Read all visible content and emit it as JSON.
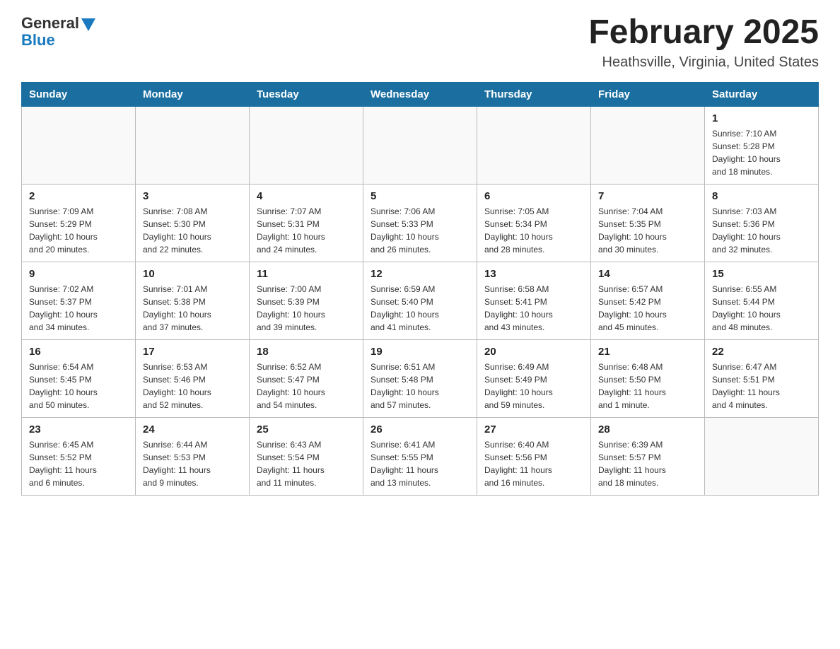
{
  "logo": {
    "general": "General",
    "blue": "Blue"
  },
  "header": {
    "title": "February 2025",
    "location": "Heathsville, Virginia, United States"
  },
  "weekdays": [
    "Sunday",
    "Monday",
    "Tuesday",
    "Wednesday",
    "Thursday",
    "Friday",
    "Saturday"
  ],
  "weeks": [
    [
      {
        "day": "",
        "info": ""
      },
      {
        "day": "",
        "info": ""
      },
      {
        "day": "",
        "info": ""
      },
      {
        "day": "",
        "info": ""
      },
      {
        "day": "",
        "info": ""
      },
      {
        "day": "",
        "info": ""
      },
      {
        "day": "1",
        "info": "Sunrise: 7:10 AM\nSunset: 5:28 PM\nDaylight: 10 hours\nand 18 minutes."
      }
    ],
    [
      {
        "day": "2",
        "info": "Sunrise: 7:09 AM\nSunset: 5:29 PM\nDaylight: 10 hours\nand 20 minutes."
      },
      {
        "day": "3",
        "info": "Sunrise: 7:08 AM\nSunset: 5:30 PM\nDaylight: 10 hours\nand 22 minutes."
      },
      {
        "day": "4",
        "info": "Sunrise: 7:07 AM\nSunset: 5:31 PM\nDaylight: 10 hours\nand 24 minutes."
      },
      {
        "day": "5",
        "info": "Sunrise: 7:06 AM\nSunset: 5:33 PM\nDaylight: 10 hours\nand 26 minutes."
      },
      {
        "day": "6",
        "info": "Sunrise: 7:05 AM\nSunset: 5:34 PM\nDaylight: 10 hours\nand 28 minutes."
      },
      {
        "day": "7",
        "info": "Sunrise: 7:04 AM\nSunset: 5:35 PM\nDaylight: 10 hours\nand 30 minutes."
      },
      {
        "day": "8",
        "info": "Sunrise: 7:03 AM\nSunset: 5:36 PM\nDaylight: 10 hours\nand 32 minutes."
      }
    ],
    [
      {
        "day": "9",
        "info": "Sunrise: 7:02 AM\nSunset: 5:37 PM\nDaylight: 10 hours\nand 34 minutes."
      },
      {
        "day": "10",
        "info": "Sunrise: 7:01 AM\nSunset: 5:38 PM\nDaylight: 10 hours\nand 37 minutes."
      },
      {
        "day": "11",
        "info": "Sunrise: 7:00 AM\nSunset: 5:39 PM\nDaylight: 10 hours\nand 39 minutes."
      },
      {
        "day": "12",
        "info": "Sunrise: 6:59 AM\nSunset: 5:40 PM\nDaylight: 10 hours\nand 41 minutes."
      },
      {
        "day": "13",
        "info": "Sunrise: 6:58 AM\nSunset: 5:41 PM\nDaylight: 10 hours\nand 43 minutes."
      },
      {
        "day": "14",
        "info": "Sunrise: 6:57 AM\nSunset: 5:42 PM\nDaylight: 10 hours\nand 45 minutes."
      },
      {
        "day": "15",
        "info": "Sunrise: 6:55 AM\nSunset: 5:44 PM\nDaylight: 10 hours\nand 48 minutes."
      }
    ],
    [
      {
        "day": "16",
        "info": "Sunrise: 6:54 AM\nSunset: 5:45 PM\nDaylight: 10 hours\nand 50 minutes."
      },
      {
        "day": "17",
        "info": "Sunrise: 6:53 AM\nSunset: 5:46 PM\nDaylight: 10 hours\nand 52 minutes."
      },
      {
        "day": "18",
        "info": "Sunrise: 6:52 AM\nSunset: 5:47 PM\nDaylight: 10 hours\nand 54 minutes."
      },
      {
        "day": "19",
        "info": "Sunrise: 6:51 AM\nSunset: 5:48 PM\nDaylight: 10 hours\nand 57 minutes."
      },
      {
        "day": "20",
        "info": "Sunrise: 6:49 AM\nSunset: 5:49 PM\nDaylight: 10 hours\nand 59 minutes."
      },
      {
        "day": "21",
        "info": "Sunrise: 6:48 AM\nSunset: 5:50 PM\nDaylight: 11 hours\nand 1 minute."
      },
      {
        "day": "22",
        "info": "Sunrise: 6:47 AM\nSunset: 5:51 PM\nDaylight: 11 hours\nand 4 minutes."
      }
    ],
    [
      {
        "day": "23",
        "info": "Sunrise: 6:45 AM\nSunset: 5:52 PM\nDaylight: 11 hours\nand 6 minutes."
      },
      {
        "day": "24",
        "info": "Sunrise: 6:44 AM\nSunset: 5:53 PM\nDaylight: 11 hours\nand 9 minutes."
      },
      {
        "day": "25",
        "info": "Sunrise: 6:43 AM\nSunset: 5:54 PM\nDaylight: 11 hours\nand 11 minutes."
      },
      {
        "day": "26",
        "info": "Sunrise: 6:41 AM\nSunset: 5:55 PM\nDaylight: 11 hours\nand 13 minutes."
      },
      {
        "day": "27",
        "info": "Sunrise: 6:40 AM\nSunset: 5:56 PM\nDaylight: 11 hours\nand 16 minutes."
      },
      {
        "day": "28",
        "info": "Sunrise: 6:39 AM\nSunset: 5:57 PM\nDaylight: 11 hours\nand 18 minutes."
      },
      {
        "day": "",
        "info": ""
      }
    ]
  ]
}
